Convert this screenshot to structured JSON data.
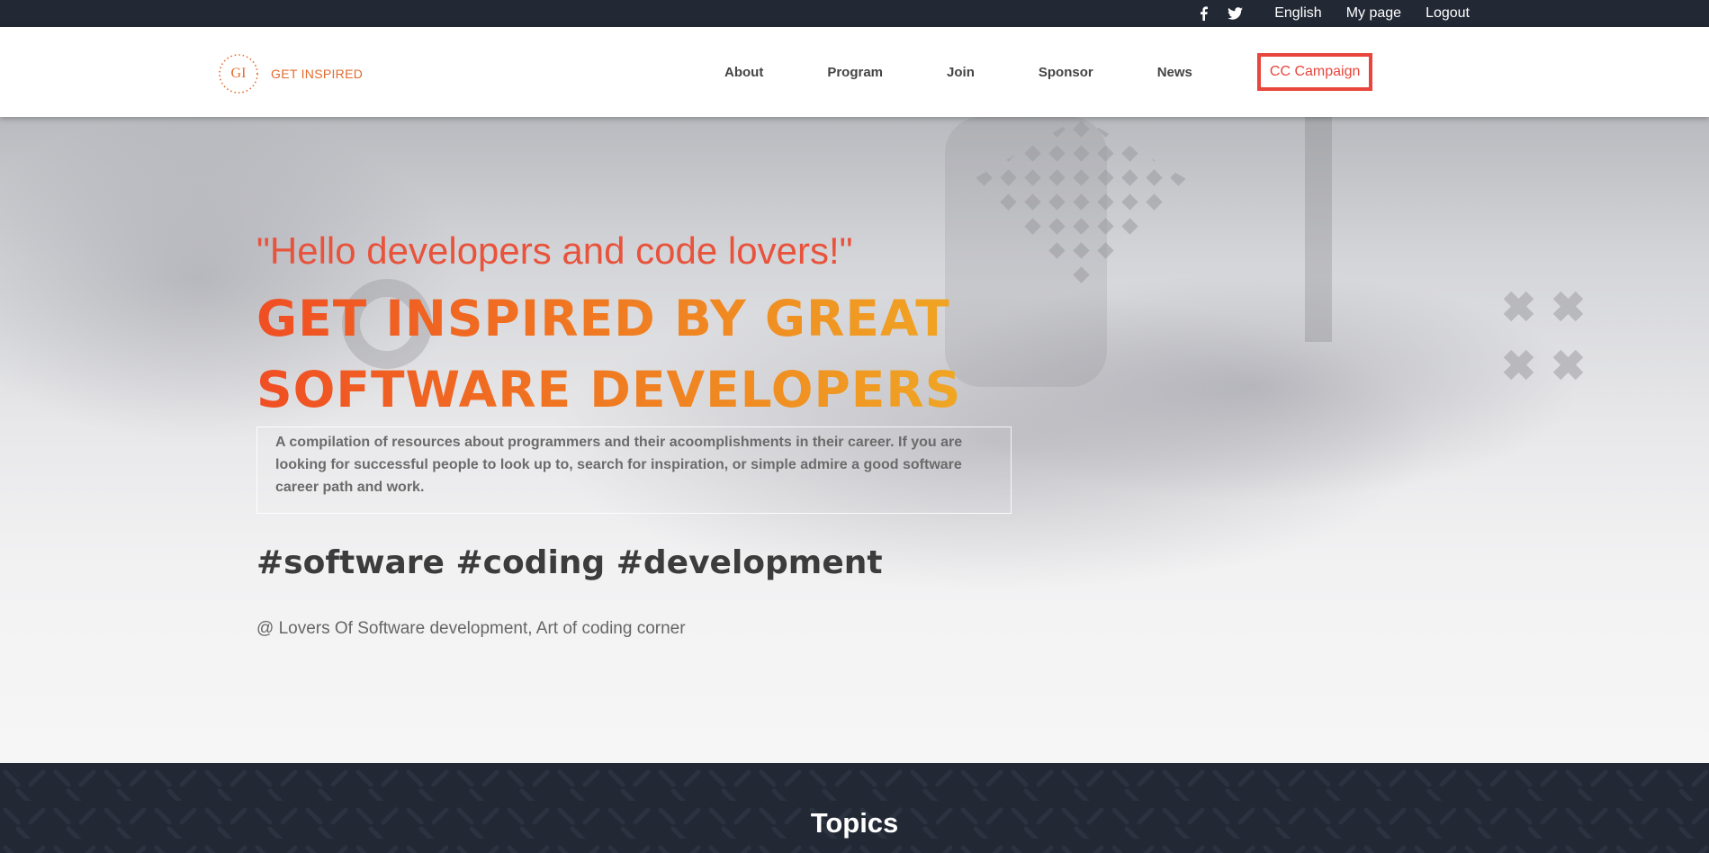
{
  "topbar": {
    "social": [
      {
        "icon": "facebook-icon"
      },
      {
        "icon": "twitter-icon"
      }
    ],
    "language": "English",
    "my_page": "My page",
    "logout": "Logout"
  },
  "header": {
    "logo": {
      "initials": "GI",
      "text": "GET INSPIRED"
    },
    "nav": [
      "About",
      "Program",
      "Join",
      "Sponsor",
      "News"
    ],
    "cta": "CC Campaign"
  },
  "hero": {
    "quote": "\"Hello developers and code lovers!\"",
    "headline_line1": "GET INSPIRED BY GREAT",
    "headline_line2": "SOFTWARE DEVELOPERS",
    "description": "A compilation of resources about programmers and their acoomplishments in their career. If you are looking for successful people to look up to, search for inspiration, or simple admire a good software career path and work.",
    "hashtags": "#software #coding #development",
    "byline": "@ Lovers Of Software development, Art of coding corner"
  },
  "topics": {
    "title": "Topics"
  },
  "colors": {
    "dark_bar": "#222834",
    "accent_red": "#e8453c",
    "accent_orange": "#f07b22",
    "logo_orange": "#e36b2d"
  }
}
